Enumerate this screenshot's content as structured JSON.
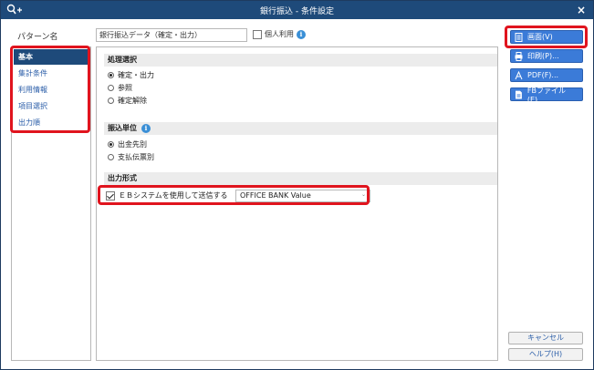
{
  "window": {
    "title": "銀行振込 - 条件設定",
    "close_glyph": "×"
  },
  "header": {
    "pattern_label": "パターン名",
    "pattern_value": "銀行振込データ（確定・出力）",
    "personal_use_label": "個人利用",
    "info_glyph": "i"
  },
  "sidebar": {
    "items": [
      {
        "label": "基本",
        "active": true
      },
      {
        "label": "集計条件"
      },
      {
        "label": "利用情報"
      },
      {
        "label": "項目選択"
      },
      {
        "label": "出力順"
      }
    ]
  },
  "sections": {
    "processing": {
      "title": "処理選択",
      "options": [
        "確定・出力",
        "参照",
        "確定解除"
      ],
      "selected": "確定・出力"
    },
    "transfer_unit": {
      "title": "振込単位",
      "options": [
        "出金先別",
        "支払伝票別"
      ],
      "selected": "出金先別"
    },
    "output_format": {
      "title": "出力形式",
      "eb_label": "ＥＢシステムを使用して送信する",
      "eb_checked": true,
      "system_value": "OFFICE BANK Value",
      "dropdown_glyph": "⌄"
    }
  },
  "actions": {
    "screen": "画面(V)",
    "print": "印刷(P)...",
    "pdf": "PDF(F)...",
    "fb_file": "FBファイル(E)...",
    "cancel": "キャンセル",
    "help": "ヘルプ(H)"
  },
  "colors": {
    "accent": "#3b7bd8",
    "titlebar": "#1e4a7a",
    "highlight": "#e0141e"
  }
}
